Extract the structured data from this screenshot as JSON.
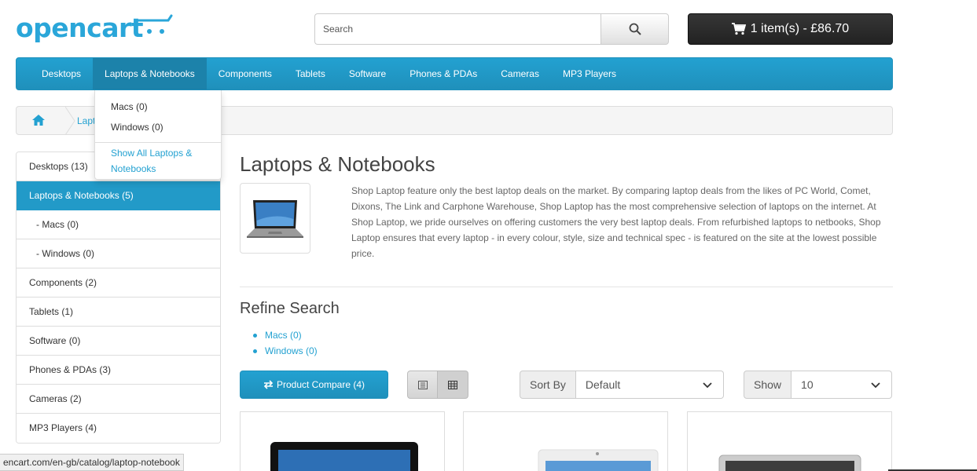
{
  "header": {
    "logo_text": "opencart",
    "search": {
      "placeholder": "Search",
      "value": ""
    },
    "cart_label": "1 item(s) - £86.70"
  },
  "menu": {
    "items": [
      "Desktops",
      "Laptops & Notebooks",
      "Components",
      "Tablets",
      "Software",
      "Phones & PDAs",
      "Cameras",
      "MP3 Players"
    ],
    "active_index": 1,
    "dropdown": {
      "items": [
        "Macs (0)",
        "Windows (0)"
      ],
      "show_all": "Show All Laptops & Notebooks"
    }
  },
  "breadcrumb": {
    "link": "Laptops & Notebooks"
  },
  "sidebar": {
    "items": [
      {
        "label": "Desktops (13)"
      },
      {
        "label": "Laptops & Notebooks (5)",
        "active": true
      },
      {
        "label": "- Macs (0)",
        "sub": true
      },
      {
        "label": "- Windows (0)",
        "sub": true
      },
      {
        "label": "Components (2)"
      },
      {
        "label": "Tablets (1)"
      },
      {
        "label": "Software (0)"
      },
      {
        "label": "Phones & PDAs (3)"
      },
      {
        "label": "Cameras (2)"
      },
      {
        "label": "MP3 Players (4)"
      }
    ]
  },
  "content": {
    "title": "Laptops & Notebooks",
    "description": "Shop Laptop feature only the best laptop deals on the market. By comparing laptop deals from the likes of PC World, Comet, Dixons, The Link and Carphone Warehouse, Shop Laptop has the most comprehensive selection of laptops on the internet. At Shop Laptop, we pride ourselves on offering customers the very best laptop deals. From refurbished laptops to netbooks, Shop Laptop ensures that every laptop - in every colour, style, size and technical spec - is featured on the site at the lowest possible price.",
    "refine_title": "Refine Search",
    "refine_links": [
      "Macs (0)",
      "Windows (0)"
    ],
    "compare_label": "Product Compare (4)",
    "sort_label": "Sort By",
    "sort_value": "Default",
    "show_label": "Show",
    "show_value": "10"
  },
  "status_url": "encart.com/en-gb/catalog/laptop-notebook",
  "colors": {
    "accent": "#23a1d1",
    "active": "#229ac8",
    "cart": "#2b2b2b"
  },
  "icons": [
    "search-icon",
    "cart-icon",
    "home-icon",
    "exchange-icon",
    "list-icon",
    "grid-icon",
    "chevron-down-icon"
  ]
}
